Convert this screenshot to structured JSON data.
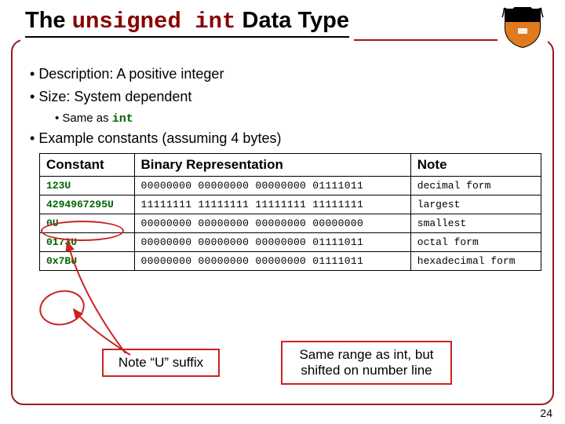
{
  "title": {
    "pre": "The ",
    "kw": "unsigned int",
    "post": " Data Type"
  },
  "bullets": {
    "desc": "Description:  A positive integer",
    "size": "Size:  System dependent",
    "size_sub_pre": "Same as ",
    "size_sub_kw": "int",
    "examples": "Example constants (assuming 4 bytes)"
  },
  "table": {
    "headers": {
      "c0": "Constant",
      "c1": "Binary Representation",
      "c2": "Note"
    },
    "rows": [
      {
        "constant": "123U",
        "binary": "00000000 00000000 00000000 01111011",
        "note": "decimal form"
      },
      {
        "constant": "4294967295U",
        "binary": "11111111 11111111 11111111 11111111",
        "note": "largest"
      },
      {
        "constant": "0U",
        "binary": "00000000 00000000 00000000 00000000",
        "note": "smallest"
      },
      {
        "constant": "0173U",
        "binary": "00000000 00000000 00000000 01111011",
        "note": "octal form"
      },
      {
        "constant": "0x7BU",
        "binary": "00000000 00000000 00000000 01111011",
        "note": "hexadecimal form"
      }
    ]
  },
  "callouts": {
    "u_suffix": "Note “U” suffix",
    "range_note": "Same range as int, but shifted on number line"
  },
  "page": "24"
}
